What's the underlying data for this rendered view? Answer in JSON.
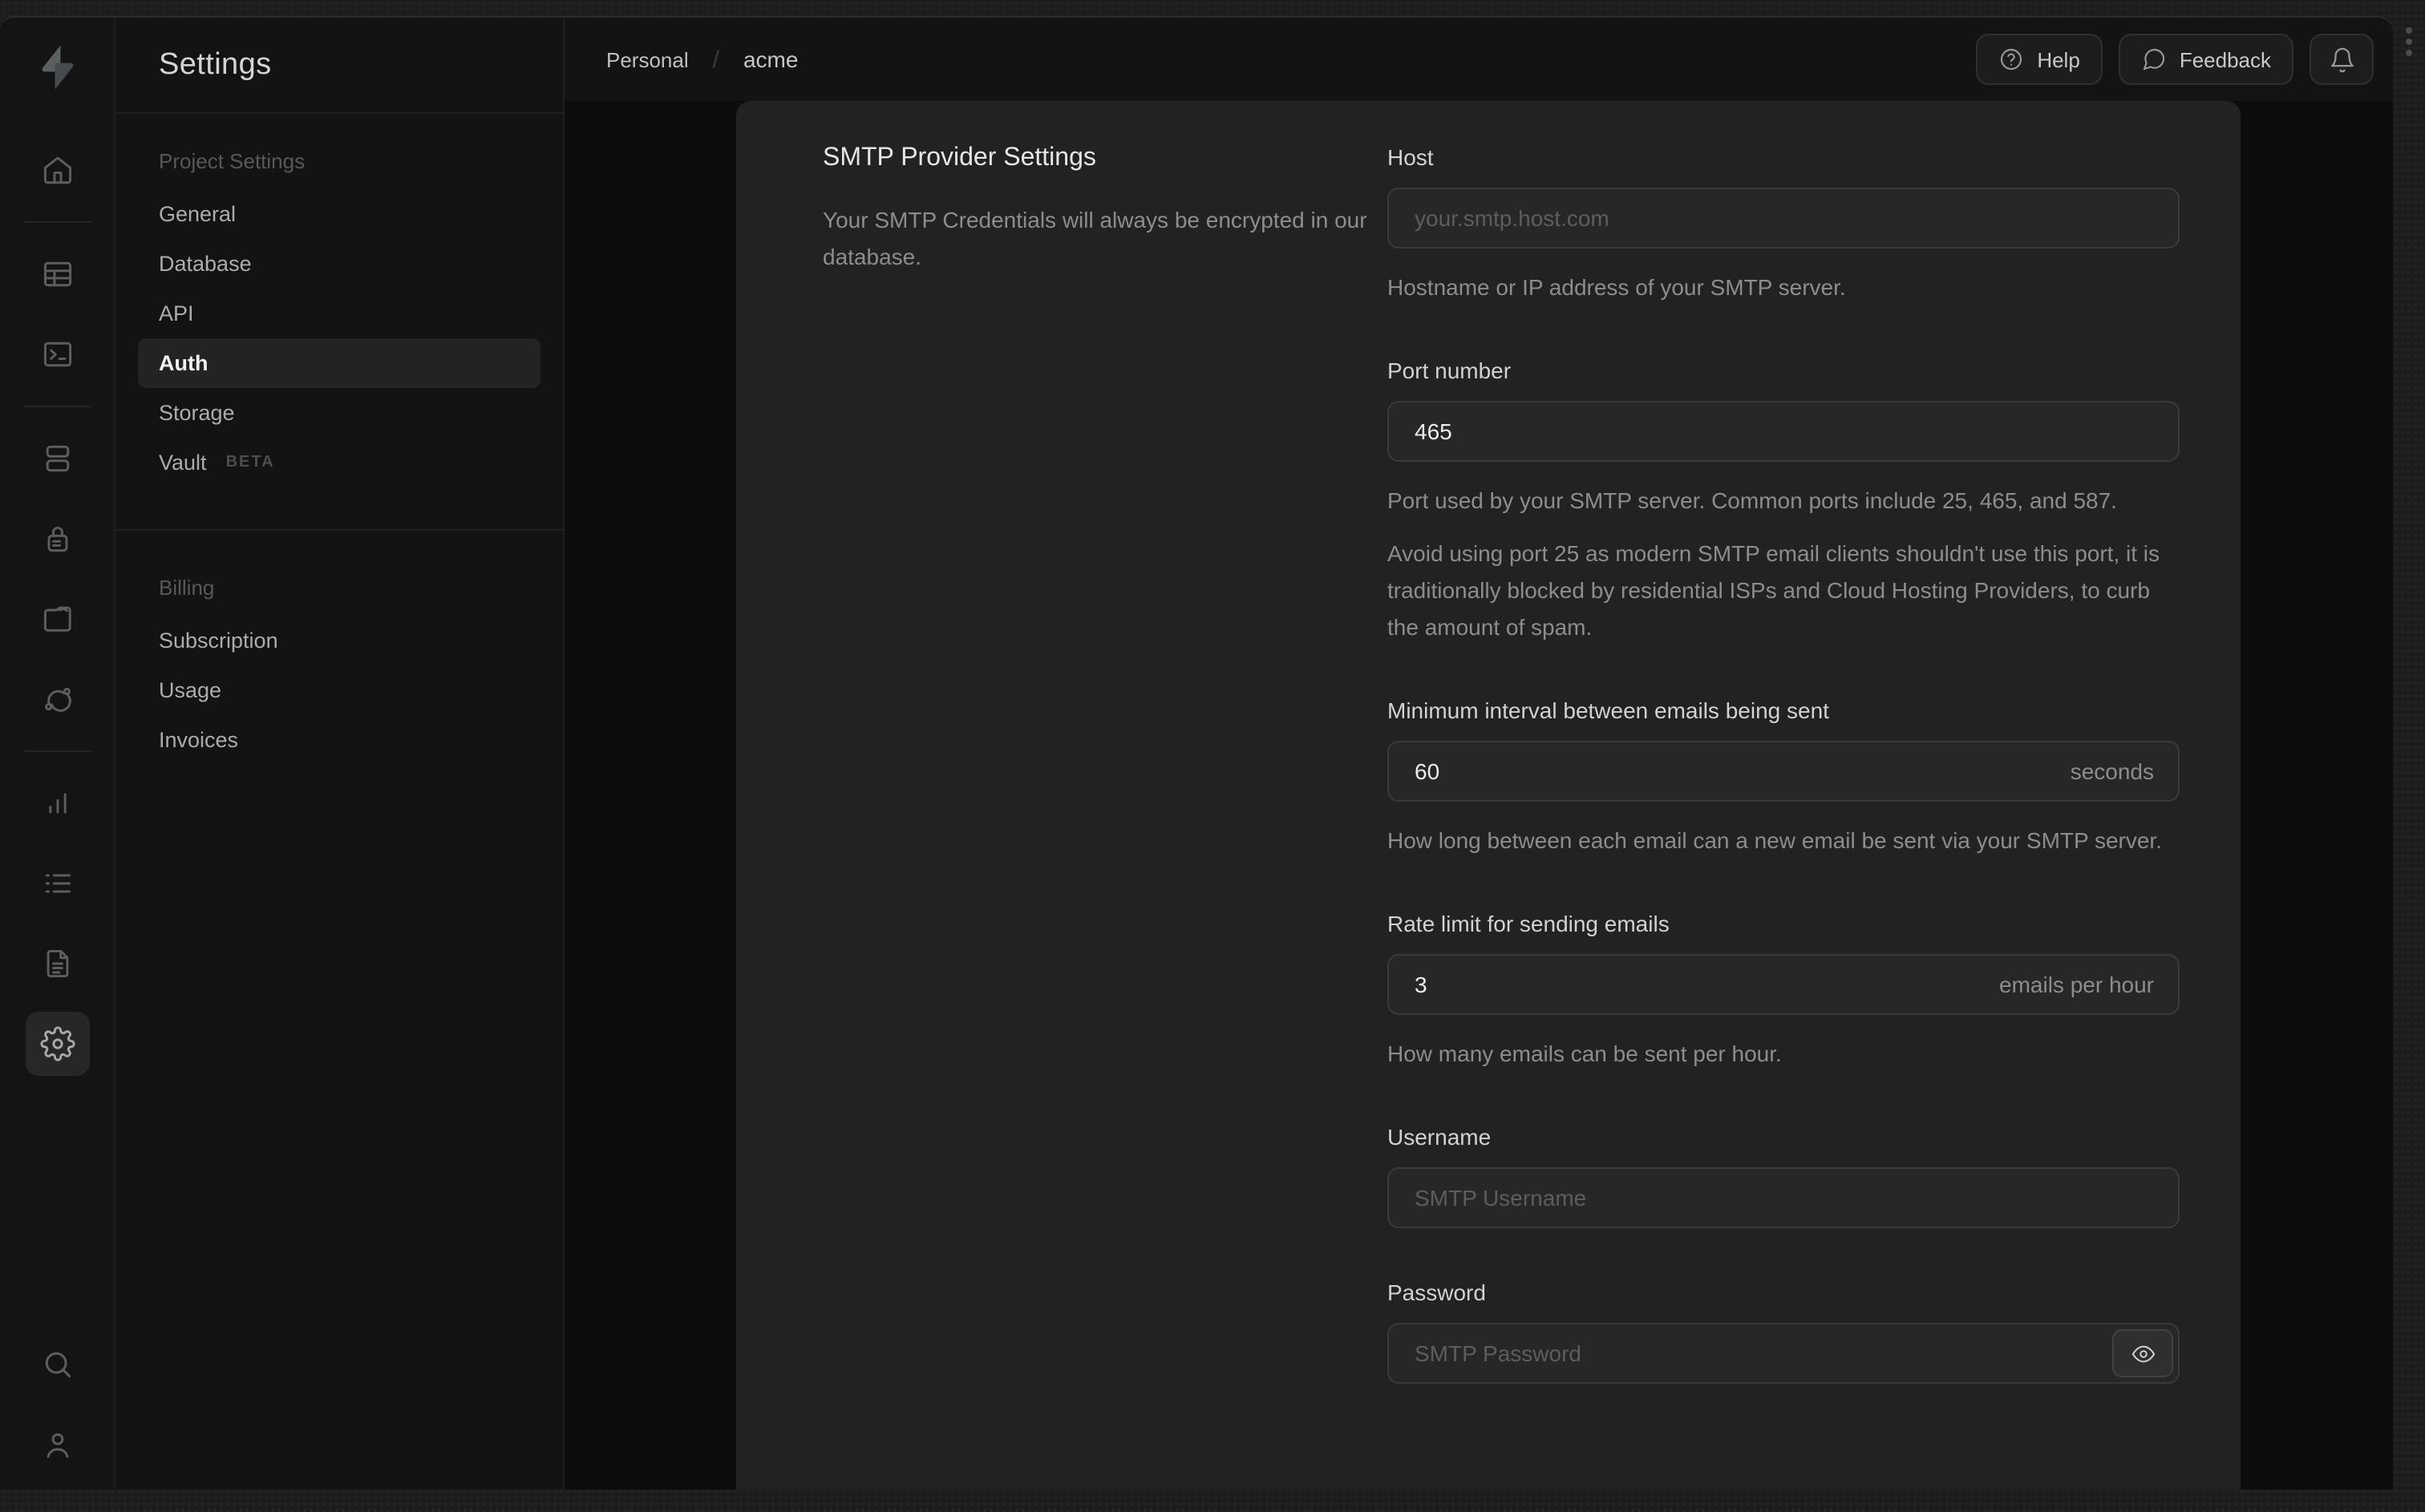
{
  "rail": {
    "icons": [
      "supabase-logo",
      "home",
      "table-editor",
      "sql-editor",
      "database",
      "authentication",
      "storage",
      "edge-functions",
      "reports",
      "logs",
      "api-docs",
      "project-settings",
      "search",
      "user"
    ],
    "active_icon": "project-settings"
  },
  "nav": {
    "title": "Settings",
    "beta_badge": "BETA",
    "active_item": "Auth",
    "sections": [
      {
        "label": "Project Settings",
        "items": [
          "General",
          "Database",
          "API",
          "Auth",
          "Storage",
          "Vault"
        ]
      },
      {
        "label": "Billing",
        "items": [
          "Subscription",
          "Usage",
          "Invoices"
        ]
      }
    ]
  },
  "topbar": {
    "breadcrumb": {
      "org": "Personal",
      "separator": "/",
      "project": "acme"
    },
    "help_label": "Help",
    "feedback_label": "Feedback"
  },
  "panel": {
    "title": "SMTP Provider Settings",
    "description": "Your SMTP Credentials will always be encrypted in our database.",
    "fields": {
      "host": {
        "label": "Host",
        "placeholder": "your.smtp.host.com",
        "helper": "Hostname or IP address of your SMTP server."
      },
      "port": {
        "label": "Port number",
        "value": "465",
        "helper": "Port used by your SMTP server. Common ports include 25, 465, and 587.",
        "note": "Avoid using port 25 as modern SMTP email clients shouldn't use this port, it is traditionally blocked by residential ISPs and Cloud Hosting Providers, to curb the amount of spam."
      },
      "interval": {
        "label": "Minimum interval between emails being sent",
        "value": "60",
        "suffix": "seconds",
        "helper": "How long between each email can a new email be sent via your SMTP server."
      },
      "rate": {
        "label": "Rate limit for sending emails",
        "value": "3",
        "suffix": "emails per hour",
        "helper": "How many emails can be sent per hour."
      },
      "username": {
        "label": "Username",
        "placeholder": "SMTP Username"
      },
      "password": {
        "label": "Password",
        "placeholder": "SMTP Password"
      }
    }
  }
}
